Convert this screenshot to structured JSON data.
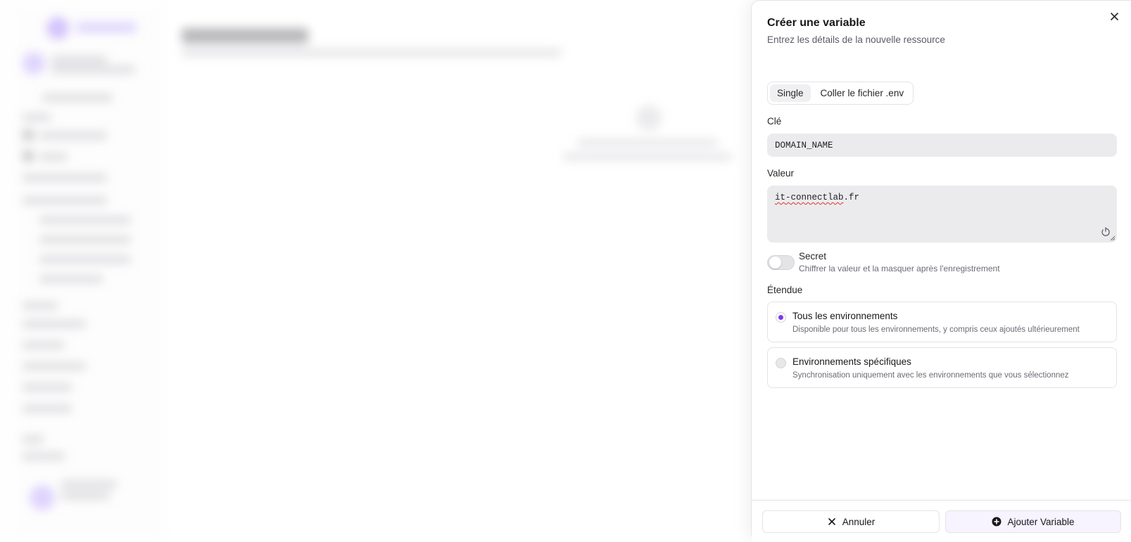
{
  "sheet": {
    "title": "Créer une variable",
    "description": "Entrez les détails de la nouvelle ressource",
    "close_icon": "close-icon"
  },
  "tabs": [
    {
      "label": "Single",
      "active": true
    },
    {
      "label": "Coller le fichier .env",
      "active": false
    }
  ],
  "key_field": {
    "label": "Clé",
    "value": "DOMAIN_NAME"
  },
  "value_field": {
    "label": "Valeur",
    "value_part1": "it-connectlab",
    "value_part2": ".fr"
  },
  "secret": {
    "title": "Secret",
    "description": "Chiffrer la valeur et la masquer après l'enregistrement",
    "enabled": false
  },
  "scope": {
    "label": "Étendue",
    "options": [
      {
        "title": "Tous les environnements",
        "description": "Disponible pour tous les environnements, y compris ceux ajoutés ultérieurement",
        "selected": true
      },
      {
        "title": "Environnements spécifiques",
        "description": "Synchronisation uniquement avec les environnements que vous sélectionnez",
        "selected": false
      }
    ]
  },
  "footer": {
    "cancel_label": "Annuler",
    "submit_label": "Ajouter Variable"
  },
  "colors": {
    "accent": "#7c3aed"
  }
}
